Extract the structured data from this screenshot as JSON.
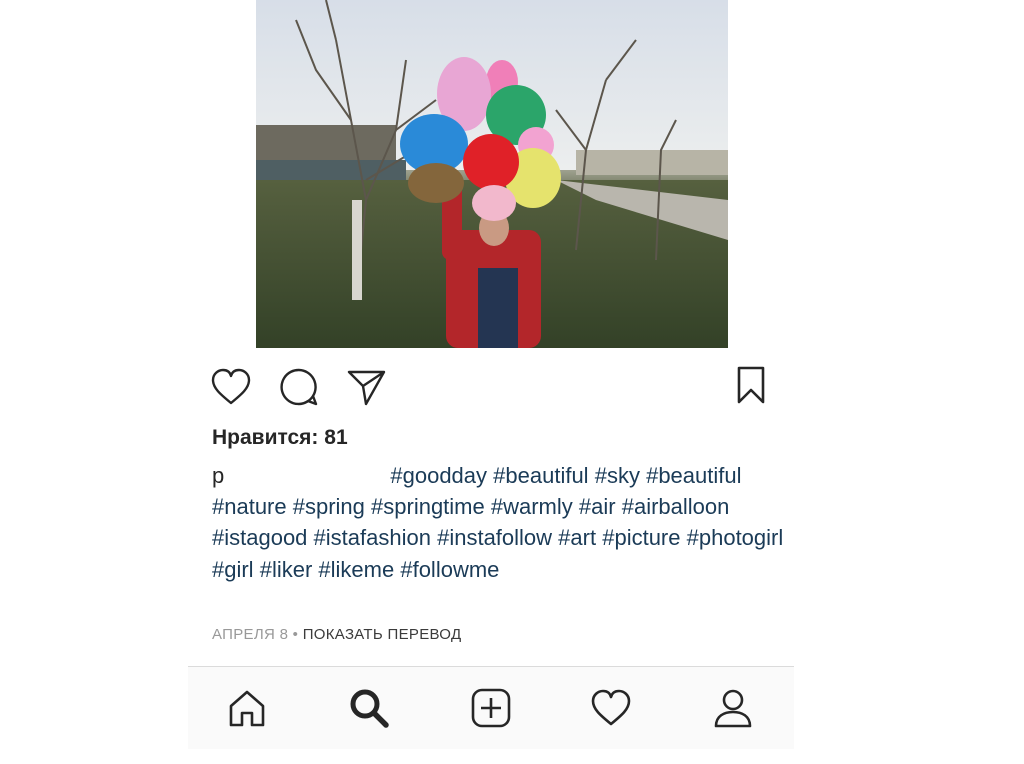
{
  "post": {
    "likes_text": "Нравится: 81",
    "username": "p",
    "caption_tags": [
      "#goodday",
      "#beautiful",
      "#sky",
      "#beautiful",
      "#nature",
      "#spring",
      "#springtime",
      "#warmly",
      "#air",
      "#airballoon",
      "#istagood",
      "#istafashion",
      "#instafollow",
      "#art",
      "#picture",
      "#photogirl",
      "#girl",
      "#liker",
      "#likeme",
      "#followme"
    ],
    "date": "АПРЕЛЯ 8",
    "separator": " • ",
    "translate_label": "ПОКАЗАТЬ ПЕРЕВОД"
  },
  "actions": {
    "like_icon": "heart-outline-icon",
    "comment_icon": "comment-bubble-icon",
    "share_icon": "paper-plane-icon",
    "save_icon": "bookmark-icon"
  },
  "tabbar": {
    "items": [
      "home-icon",
      "search-icon",
      "new-post-icon",
      "activity-heart-icon",
      "profile-icon"
    ],
    "active": "search-icon"
  },
  "colors": {
    "hashtag": "#1b3b57",
    "text": "#262626",
    "meta": "#999999"
  }
}
